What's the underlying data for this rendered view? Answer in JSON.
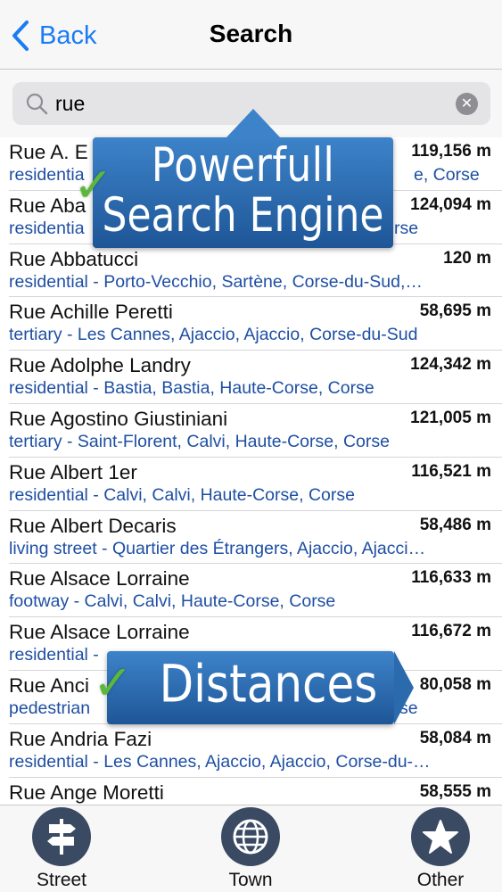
{
  "nav": {
    "back_label": "Back",
    "title": "Search"
  },
  "search": {
    "value": "rue",
    "placeholder": ""
  },
  "results": [
    {
      "name": "Rue A. E",
      "distance": "119,156 m",
      "description": "residentia",
      "description_tail": "e, Corse"
    },
    {
      "name": "Rue Aba",
      "distance": "124,094 m",
      "description": "residentia",
      "description_tail": "rse"
    },
    {
      "name": "Rue Abbatucci",
      "distance": "120 m",
      "description": "residential - Porto-Vecchio, Sartène, Corse-du-Sud,…"
    },
    {
      "name": "Rue Achille Peretti",
      "distance": "58,695 m",
      "description": "tertiary - Les Cannes, Ajaccio, Ajaccio, Corse-du-Sud"
    },
    {
      "name": "Rue Adolphe Landry",
      "distance": "124,342 m",
      "description": "residential - Bastia, Bastia, Haute-Corse, Corse"
    },
    {
      "name": "Rue Agostino Giustiniani",
      "distance": "121,005 m",
      "description": "tertiary - Saint-Florent, Calvi, Haute-Corse, Corse"
    },
    {
      "name": "Rue Albert 1er",
      "distance": "116,521 m",
      "description": "residential - Calvi, Calvi, Haute-Corse, Corse"
    },
    {
      "name": "Rue Albert Decaris",
      "distance": "58,486 m",
      "description": "living street - Quartier des Étrangers, Ajaccio, Ajacci…"
    },
    {
      "name": "Rue Alsace Lorraine",
      "distance": "116,633 m",
      "description": "footway - Calvi, Calvi, Haute-Corse, Corse"
    },
    {
      "name": "Rue Alsace Lorraine",
      "distance": "116,672 m",
      "description": "residential -"
    },
    {
      "name": "Rue Anci",
      "distance": "80,058 m",
      "description": "pedestrian",
      "description_tail": "se"
    },
    {
      "name": "Rue Andria Fazi",
      "distance": "58,084 m",
      "description": "residential - Les Cannes, Ajaccio, Ajaccio, Corse-du-…"
    },
    {
      "name": "Rue Ange Moretti",
      "distance": "58,555 m",
      "description": ""
    }
  ],
  "promo": {
    "line1": "Powerfull",
    "line2": "Search Engine",
    "distances": "Distances"
  },
  "tabs": [
    {
      "label": "Street",
      "icon": "signpost-icon"
    },
    {
      "label": "Town",
      "icon": "globe-icon"
    },
    {
      "label": "Other",
      "icon": "star-icon"
    }
  ],
  "colors": {
    "accent": "#1a7cf5",
    "description": "#1e4fa3",
    "callout": "#2b6aad",
    "check": "#5cb83a",
    "tab_icon_bg": "#3a4a63"
  }
}
